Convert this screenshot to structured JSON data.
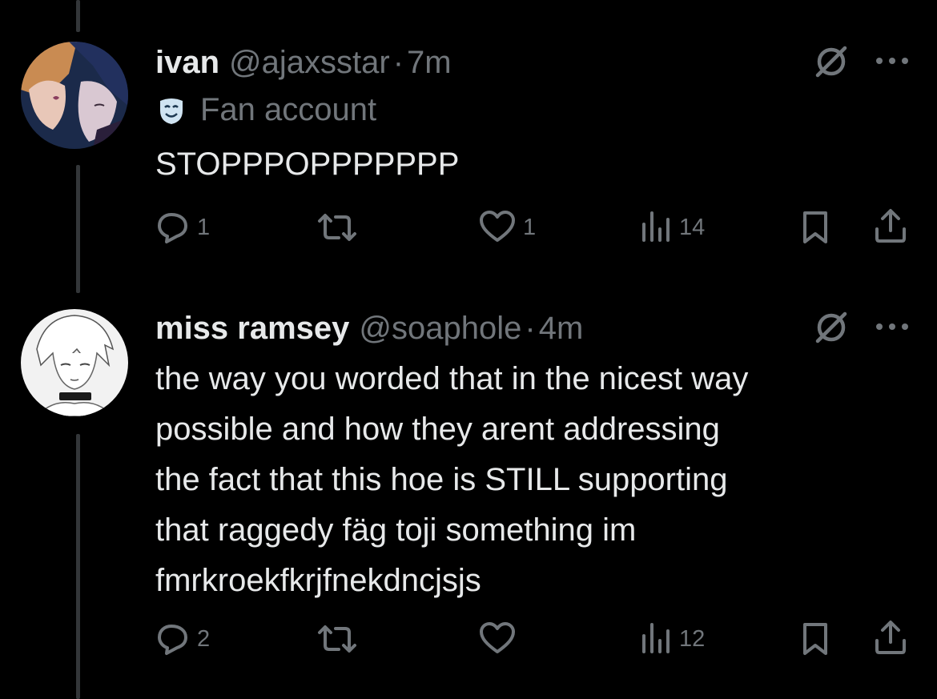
{
  "tweets": [
    {
      "display_name": "ivan",
      "handle": "@ajaxsstar",
      "separator": "·",
      "time": "7m",
      "label": "Fan account",
      "label_icon": "mask-icon",
      "text": "STOPPPOPPPPPPP",
      "actions": {
        "reply_count": "1",
        "repost_count": "",
        "like_count": "1",
        "views_count": "14"
      }
    },
    {
      "display_name": "miss ramsey",
      "handle": "@soaphole",
      "separator": "·",
      "time": "4m",
      "text": "the way you worded that in the nicest way\npossible and how they arent addressing\nthe fact that this hoe is STILL supporting\nthat raggedy fäg toji something im\nfmrkroekfkrjfnekdncjsjs",
      "actions": {
        "reply_count": "2",
        "repost_count": "",
        "like_count": "",
        "views_count": "12"
      }
    }
  ],
  "colors": {
    "background": "#000000",
    "text_primary": "#e7e9ea",
    "text_secondary": "#71767b",
    "thread_line": "#333639"
  }
}
